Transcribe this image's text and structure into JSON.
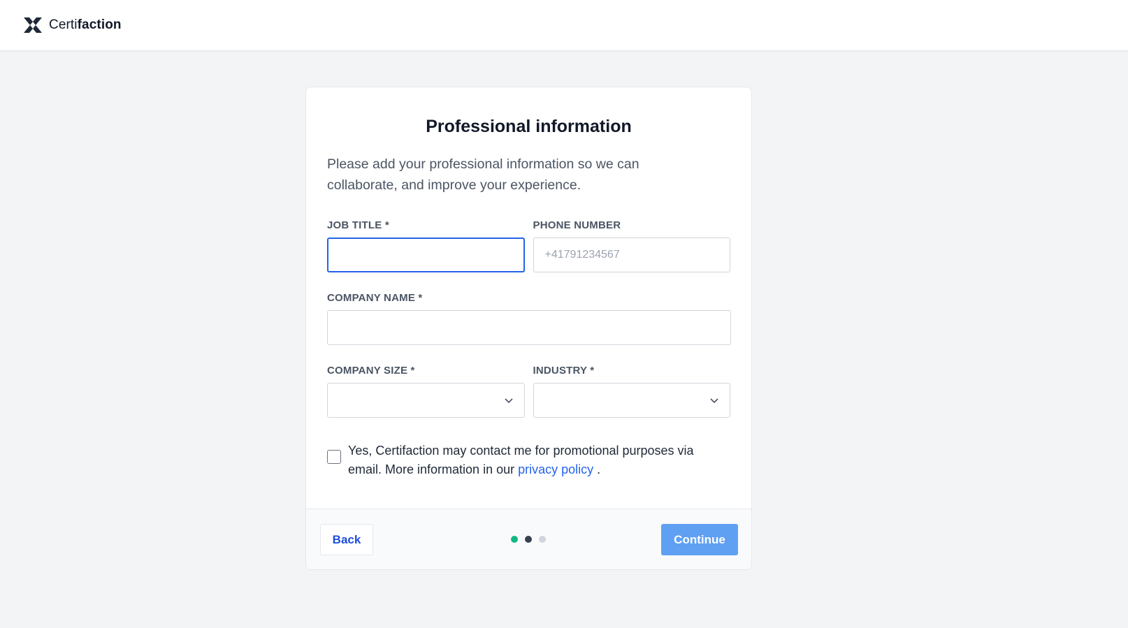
{
  "brand": {
    "name_light": "Certi",
    "name_bold": "faction",
    "logo_icon": "certifaction-logo-icon"
  },
  "card": {
    "title": "Professional information",
    "description": "Please add your professional information so we can collaborate, and improve your experience."
  },
  "form": {
    "job_title": {
      "label": "JOB TITLE *",
      "value": "",
      "placeholder": ""
    },
    "phone_number": {
      "label": "PHONE NUMBER",
      "value": "",
      "placeholder": "+41791234567"
    },
    "company_name": {
      "label": "COMPANY NAME *",
      "value": "",
      "placeholder": ""
    },
    "company_size": {
      "label": "COMPANY SIZE *",
      "selected": ""
    },
    "industry": {
      "label": "INDUSTRY *",
      "selected": ""
    },
    "consent": {
      "checked": false,
      "text_before": "Yes, Certifaction may contact me for promotional purposes via email. More information in our ",
      "link_text": "privacy policy",
      "text_after": " ."
    }
  },
  "footer": {
    "back_label": "Back",
    "continue_label": "Continue",
    "steps": [
      {
        "state": "done",
        "color": "#10b981"
      },
      {
        "state": "current",
        "color": "#374151"
      },
      {
        "state": "upcoming",
        "color": "#d1d5db"
      }
    ]
  },
  "colors": {
    "accent": "#2563eb",
    "continue_bg": "#5fa0f2",
    "page_bg": "#f3f4f6"
  }
}
